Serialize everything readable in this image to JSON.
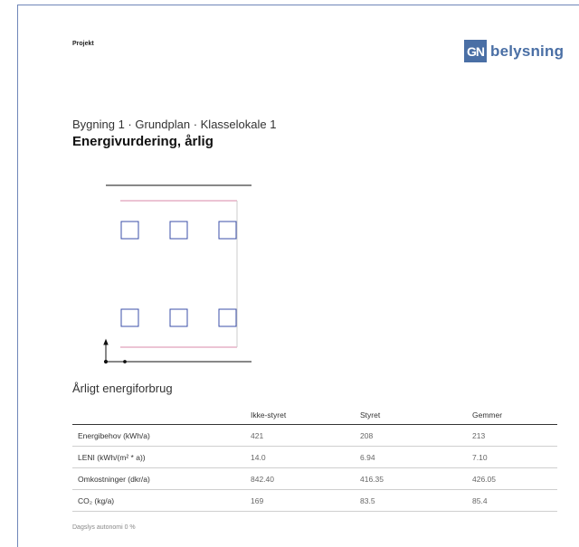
{
  "header": {
    "project_label": "Projekt",
    "logo_mark": "GN",
    "logo_text": "belysning",
    "brand_color": "#4a6fa5"
  },
  "breadcrumb": "Bygning 1 · Grundplan · Klasselokale 1",
  "page_title": "Energivurdering, årlig",
  "section_heading": "Årligt energiforbrug",
  "table": {
    "columns": [
      "",
      "Ikke-styret",
      "Styret",
      "Gemmer"
    ],
    "rows": [
      {
        "label": "Energibehov (kWh/a)",
        "values": [
          "421",
          "208",
          "213"
        ]
      },
      {
        "label": "LENI (kWh/(m² * a))",
        "values": [
          "14.0",
          "6.94",
          "7.10"
        ]
      },
      {
        "label": "Omkostninger (dkr/a)",
        "values": [
          "842.40",
          "416.35",
          "426.05"
        ]
      },
      {
        "label": "CO₂ (kg/a)",
        "values": [
          "169",
          "83.5",
          "85.4"
        ]
      }
    ]
  },
  "footnote": "Dagslys autonomi 0 %"
}
